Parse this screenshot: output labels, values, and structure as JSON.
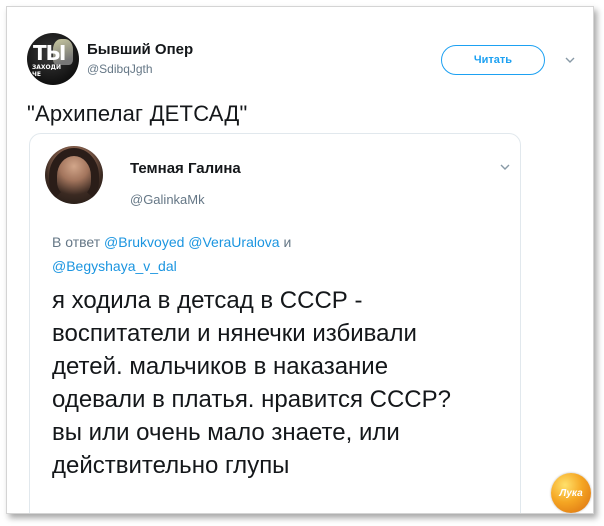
{
  "tweet": {
    "author_name": "Бывший Опер",
    "author_handle": "@SdibqJgth",
    "avatar_text_big": "ТЫ",
    "avatar_text_small": "ЗАХОДИ\nЧЕ",
    "follow_label": "Читать",
    "text": "\"Архипелаг ДЕТСАД\"",
    "menu_icon": "chevron-down-icon"
  },
  "quoted": {
    "author_name": "Темная Галина",
    "author_handle": "@GalinkaMk",
    "reply_prefix": "В ответ",
    "mentions": [
      "@Brukvoyed",
      "@VeraUralova",
      "@Begyshaya_v_dal"
    ],
    "mention_joiner": "и",
    "body_lines": [
      "я ходила в детсад в СССР -",
      "воспитатели и нянечки избивали",
      "детей. мальчиков в наказание",
      "одевали в платья. нравится СССР?",
      "вы или очень мало знаете, или",
      "действительно глупы"
    ],
    "menu_icon": "chevron-down-icon"
  },
  "watermark": {
    "logo_text": "Лука",
    "icon": "logo-badge"
  },
  "colors": {
    "accent": "#1da1f2",
    "mention": "#1b95e0",
    "secondary_text": "#657786",
    "primary_text": "#14171a"
  }
}
